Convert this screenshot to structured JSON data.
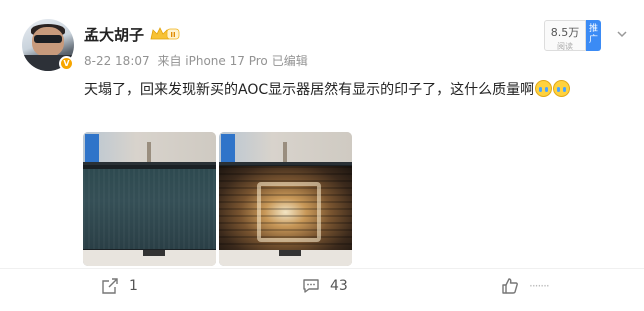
{
  "post": {
    "author": {
      "name": "孟大胡子",
      "level_badge": "II"
    },
    "meta": {
      "date": "8-22 18:07",
      "source": "来自 iPhone 17 Pro",
      "edited": "已编辑"
    },
    "promo": {
      "count": "8.5万",
      "count_label": "阅读",
      "tag": "推广"
    },
    "text": "天塌了，回来发现新买的AOC显示器居然有显示的印子了，这什么质量啊",
    "emoji_names": [
      "crying-face-emoji",
      "crying-face-emoji"
    ],
    "images": [
      {
        "name": "monitor-off-photo"
      },
      {
        "name": "monitor-on-photo"
      }
    ]
  },
  "actions": {
    "share_count": "1",
    "comment_count": "43",
    "like_count": "·······"
  },
  "colors": {
    "promo_tag": "#3b8bf5",
    "vip_badge": "#f7a600",
    "meta_text": "#939393"
  }
}
